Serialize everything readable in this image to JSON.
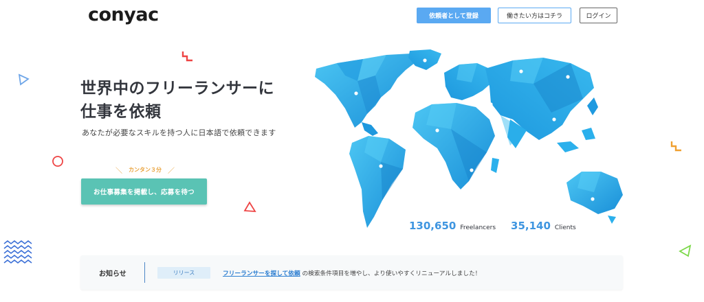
{
  "header": {
    "logo": "conyac",
    "register_client_button": "依頼者として登録",
    "register_worker_button": "働きたい方はコチラ",
    "login_button": "ログイン"
  },
  "hero": {
    "title_line1": "世界中のフリーランサーに",
    "title_line2": "仕事を依頼",
    "subtitle": "あなたが必要なスキルを持つ人に日本語で依頼できます",
    "hint": "カンタン３分",
    "hint_left": "＼",
    "hint_right": "／",
    "cta_button": "お仕事募集を掲載し、応募を待つ"
  },
  "stats": {
    "freelancers_count": "130,650",
    "freelancers_label": "Freelancers",
    "clients_count": "35,140",
    "clients_label": "Clients"
  },
  "news": {
    "title": "お知らせ",
    "badge": "リリース",
    "link_text": "フリーランサーを探して依頼",
    "text": "の検索条件項目を増やし、より使いやすくリニューアルしました！"
  },
  "colors": {
    "primary": "#5aa9f2",
    "cta": "#5ac3b4",
    "map_blue": "#2bb0ec",
    "stat_blue": "#3e95e0",
    "accent_orange": "#e9a23b",
    "accent_red": "#ee4444"
  },
  "icons": [
    "map-pin-icon",
    "triangle-outline-icon",
    "circle-outline-icon",
    "zigzag-icon",
    "wave-lines-icon"
  ]
}
